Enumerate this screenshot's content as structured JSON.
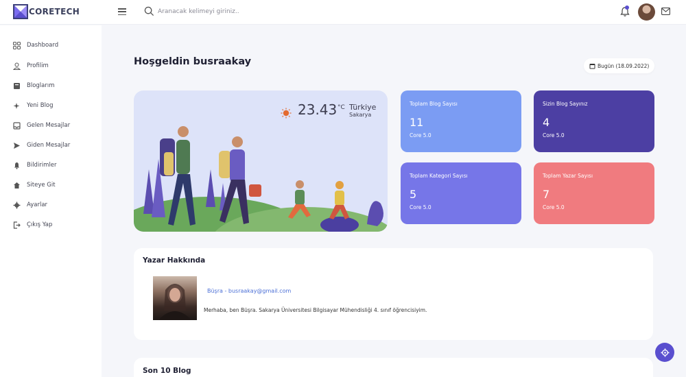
{
  "brand": {
    "name": "CORETECH"
  },
  "search": {
    "placeholder": "Aranacak kelimeyi giriniz.."
  },
  "sidebar": {
    "items": [
      {
        "label": "Dashboard",
        "icon": "grid-icon"
      },
      {
        "label": "Profilim",
        "icon": "user-icon"
      },
      {
        "label": "Bloglarım",
        "icon": "book-icon"
      },
      {
        "label": "Yeni Blog",
        "icon": "sparkle-icon"
      },
      {
        "label": "Gelen Mesajlar",
        "icon": "inbox-icon"
      },
      {
        "label": "Giden Mesajlar",
        "icon": "send-icon"
      },
      {
        "label": "Bildirimler",
        "icon": "bell-icon"
      },
      {
        "label": "Siteye Git",
        "icon": "home-icon"
      },
      {
        "label": "Ayarlar",
        "icon": "gear-icon"
      },
      {
        "label": "Çıkış Yap",
        "icon": "logout-icon"
      }
    ]
  },
  "main": {
    "welcome": "Hoşgeldin busraakay",
    "date": "Bugün (18.09.2022)",
    "weather": {
      "temp": "23.43",
      "unit": "°C",
      "country": "Türkiye",
      "city": "Sakarya"
    },
    "cards": [
      {
        "title": "Toplam Blog Sayısı",
        "value": "11",
        "sub": "Core 5.0",
        "color": "#7b9cf3"
      },
      {
        "title": "Sizin Blog Sayınız",
        "value": "4",
        "sub": "Core 5.0",
        "color": "#4c3fa3"
      },
      {
        "title": "Toplam Kategori Sayısı",
        "value": "5",
        "sub": "Core 5.0",
        "color": "#7676e8"
      },
      {
        "title": "Toplam Yazar Sayısı",
        "value": "7",
        "sub": "Core 5.0",
        "color": "#f07b7f"
      }
    ],
    "author": {
      "title": "Yazar Hakkında",
      "link": "Büşra - busraakay@gmail.com",
      "bio": "Merhaba, ben Büşra. Sakarya Üniversitesi Bilgisayar Mühendisliği 4. sınıf öğrencisiyim."
    },
    "blogs": {
      "title": "Son 10 Blog"
    }
  },
  "colors": {
    "accent": "#5a4fcf",
    "background": "#f5f6fa"
  }
}
